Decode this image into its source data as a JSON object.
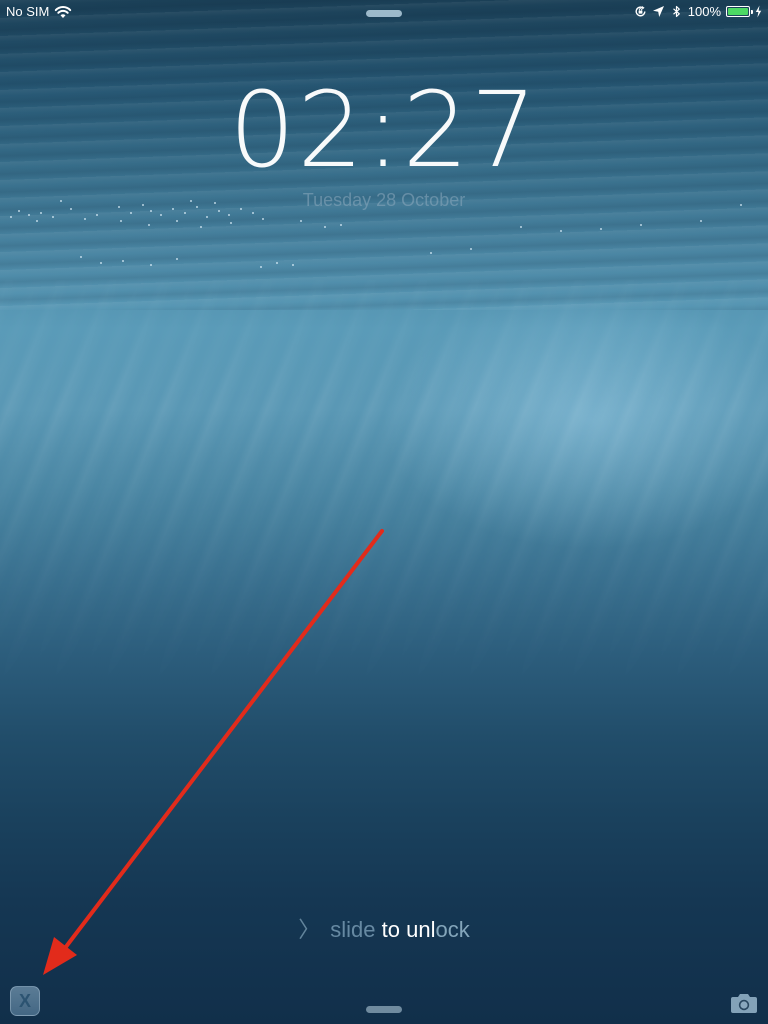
{
  "status_bar": {
    "carrier": "No SIM",
    "battery_percent": "100%",
    "battery_level": 1.0,
    "icons": [
      "wifi-icon",
      "rotation-lock-icon",
      "location-icon",
      "bluetooth-icon",
      "battery-icon",
      "charging-icon"
    ]
  },
  "lock_screen": {
    "time": "02:27",
    "date": "Tuesday 28 October"
  },
  "unlock": {
    "chevron": "〉",
    "part_a": "slide",
    "part_b": " to unl",
    "part_c": "ock"
  },
  "bottom_bar": {
    "app_badge_glyph": "X",
    "camera_icon": "camera-icon"
  },
  "annotation": {
    "type": "arrow",
    "color": "#e22b1b"
  },
  "colors": {
    "battery_fill": "#4cd964"
  }
}
